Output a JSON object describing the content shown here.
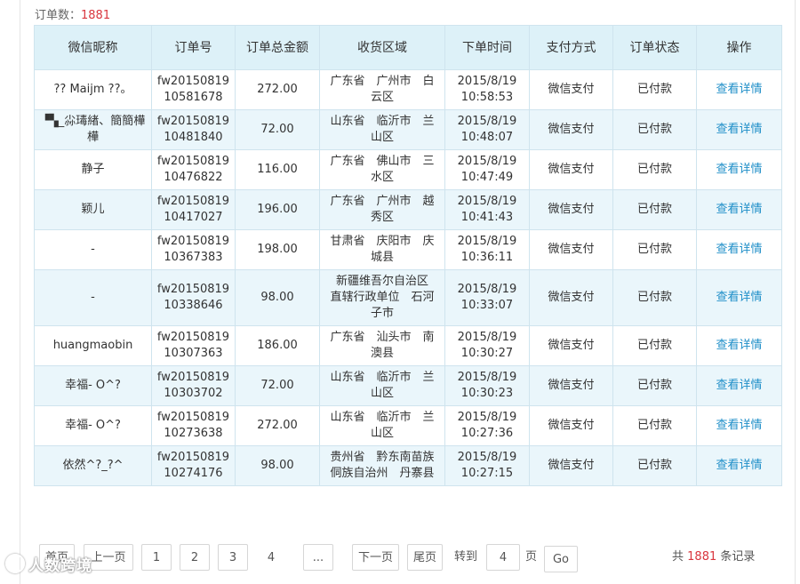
{
  "summary": {
    "label": "订单数：",
    "count": "1881"
  },
  "table": {
    "headers": [
      "微信昵称",
      "订单号",
      "订单总金额",
      "收货区域",
      "下单时间",
      "支付方式",
      "订单状态",
      "操作"
    ],
    "rows": [
      {
        "nickname": "?? Maijm ??。",
        "order_no": [
          "fw20150819",
          "10581678"
        ],
        "amount": "272.00",
        "area": [
          "广东省　广州市　白",
          "云区"
        ],
        "time": [
          "2015/8/19",
          "10:58:53"
        ],
        "pay": "微信支付",
        "status": "已付款",
        "action": "查看详情"
      },
      {
        "nickname": "▝▚_尛瑇緖、簡簡樺樺",
        "order_no": [
          "fw20150819",
          "10481840"
        ],
        "amount": "72.00",
        "area": [
          "山东省　临沂市　兰",
          "山区"
        ],
        "time": [
          "2015/8/19",
          "10:48:07"
        ],
        "pay": "微信支付",
        "status": "已付款",
        "action": "查看详情"
      },
      {
        "nickname": "静子",
        "order_no": [
          "fw20150819",
          "10476822"
        ],
        "amount": "116.00",
        "area": [
          "广东省　佛山市　三",
          "水区"
        ],
        "time": [
          "2015/8/19",
          "10:47:49"
        ],
        "pay": "微信支付",
        "status": "已付款",
        "action": "查看详情"
      },
      {
        "nickname": "颖儿",
        "order_no": [
          "fw20150819",
          "10417027"
        ],
        "amount": "196.00",
        "area": [
          "广东省　广州市　越",
          "秀区"
        ],
        "time": [
          "2015/8/19",
          "10:41:43"
        ],
        "pay": "微信支付",
        "status": "已付款",
        "action": "查看详情"
      },
      {
        "nickname": "-",
        "order_no": [
          "fw20150819",
          "10367383"
        ],
        "amount": "198.00",
        "area": [
          "甘肃省　庆阳市　庆",
          "城县"
        ],
        "time": [
          "2015/8/19",
          "10:36:11"
        ],
        "pay": "微信支付",
        "status": "已付款",
        "action": "查看详情"
      },
      {
        "nickname": "-",
        "order_no": [
          "fw20150819",
          "10338646"
        ],
        "amount": "98.00",
        "area": [
          "新疆维吾尔自治区",
          "直辖行政单位　石河",
          "子市"
        ],
        "time": [
          "2015/8/19",
          "10:33:07"
        ],
        "pay": "微信支付",
        "status": "已付款",
        "action": "查看详情"
      },
      {
        "nickname": "huangmaobin",
        "order_no": [
          "fw20150819",
          "10307363"
        ],
        "amount": "186.00",
        "area": [
          "广东省　汕头市　南",
          "澳县"
        ],
        "time": [
          "2015/8/19",
          "10:30:27"
        ],
        "pay": "微信支付",
        "status": "已付款",
        "action": "查看详情"
      },
      {
        "nickname": "幸福- O^?",
        "order_no": [
          "fw20150819",
          "10303702"
        ],
        "amount": "72.00",
        "area": [
          "山东省　临沂市　兰",
          "山区"
        ],
        "time": [
          "2015/8/19",
          "10:30:23"
        ],
        "pay": "微信支付",
        "status": "已付款",
        "action": "查看详情"
      },
      {
        "nickname": "幸福- O^?",
        "order_no": [
          "fw20150819",
          "10273638"
        ],
        "amount": "272.00",
        "area": [
          "山东省　临沂市　兰",
          "山区"
        ],
        "time": [
          "2015/8/19",
          "10:27:36"
        ],
        "pay": "微信支付",
        "status": "已付款",
        "action": "查看详情"
      },
      {
        "nickname": "依然^?_?^",
        "order_no": [
          "fw20150819",
          "10274176"
        ],
        "amount": "98.00",
        "area": [
          "贵州省　黔东南苗族",
          "侗族自治州　丹寨县"
        ],
        "time": [
          "2015/8/19",
          "10:27:15"
        ],
        "pay": "微信支付",
        "status": "已付款",
        "action": "查看详情"
      }
    ]
  },
  "pager": {
    "first": "首页",
    "prev": "上一页",
    "pages": [
      "1",
      "2",
      "3",
      "4"
    ],
    "current": "4",
    "ellipsis": "...",
    "next": "下一页",
    "last": "尾页",
    "goto_label": "转到",
    "goto_value": "4",
    "page_unit": "页",
    "go": "Go",
    "total_prefix": "共",
    "total_count": "1881",
    "total_suffix": "条记录"
  },
  "watermark": "人数跨境",
  "colors": {
    "header_bg": "#ddf1f8",
    "stripe_bg": "#eaf6fb",
    "link": "#1e8ec8",
    "accent": "#d9363e",
    "border": "#cfe4ee"
  }
}
